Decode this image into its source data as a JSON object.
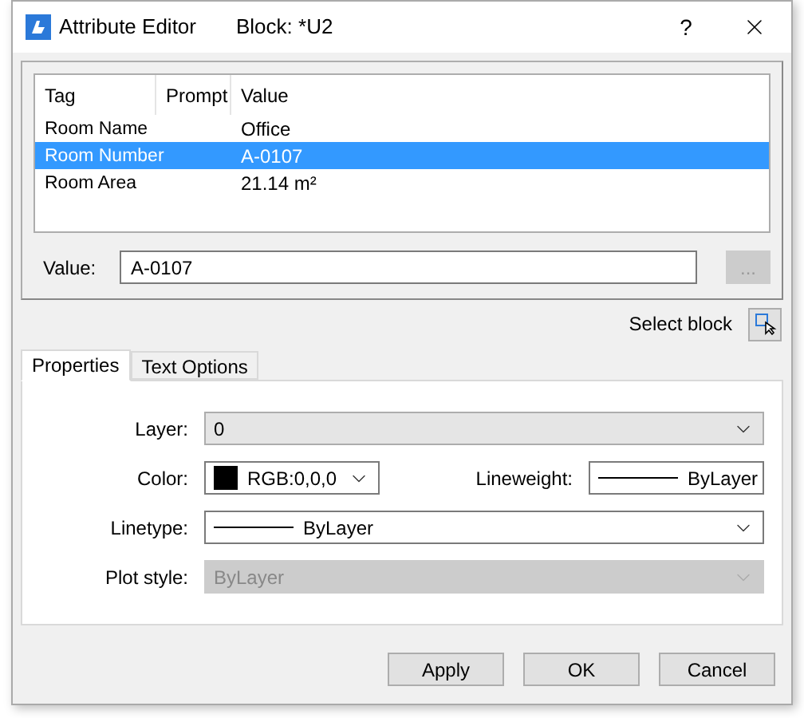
{
  "window": {
    "title": "Attribute Editor",
    "block_label": "Block: *U2",
    "help": "?"
  },
  "table": {
    "columns": [
      "Tag",
      "Prompt",
      "Value"
    ],
    "rows": [
      {
        "tag": "Room Name",
        "prompt": "",
        "value": "Office",
        "selected": false
      },
      {
        "tag": "Room Number",
        "prompt": "",
        "value": "A-0107",
        "selected": true
      },
      {
        "tag": "Room Area",
        "prompt": "",
        "value": "21.14 m²",
        "selected": false
      }
    ]
  },
  "value_field": {
    "label": "Value:",
    "value": "A-0107",
    "browse": "...",
    "browse_disabled": true
  },
  "select_block": {
    "label": "Select block"
  },
  "tabs": [
    {
      "label": "Properties",
      "selected": true
    },
    {
      "label": "Text Options",
      "selected": false
    }
  ],
  "properties": {
    "layer": {
      "label": "Layer:",
      "value": "0",
      "kind": "text",
      "disabled": false
    },
    "color": {
      "label": "Color:",
      "value": "RGB:0,0,0",
      "kind": "swatch",
      "color": "#000000",
      "disabled": false
    },
    "lineweight": {
      "label": "Lineweight:",
      "value": "ByLayer",
      "kind": "line",
      "disabled": false
    },
    "linetype": {
      "label": "Linetype:",
      "value": "ByLayer",
      "kind": "line",
      "disabled": false
    },
    "plot_style": {
      "label": "Plot style:",
      "value": "ByLayer",
      "kind": "text",
      "disabled": true
    }
  },
  "buttons": [
    "Apply",
    "OK",
    "Cancel"
  ]
}
